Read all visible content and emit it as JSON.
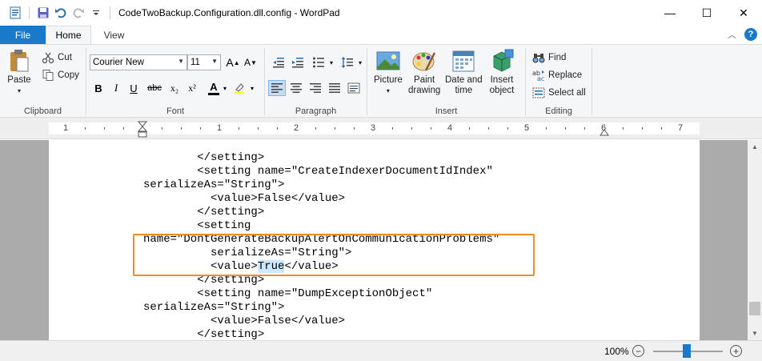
{
  "window": {
    "title": "CodeTwoBackup.Configuration.dll.config - WordPad",
    "minimize": "—",
    "maximize": "☐",
    "close": "✕"
  },
  "tabs": [
    {
      "label": "File"
    },
    {
      "label": "Home"
    },
    {
      "label": "View"
    }
  ],
  "ribbon": {
    "clipboard": {
      "label": "Clipboard",
      "paste": "Paste",
      "cut": "Cut",
      "copy": "Copy"
    },
    "font": {
      "label": "Font",
      "family": "Courier New",
      "size": "11",
      "bold": "B",
      "italic": "I",
      "underline": "U",
      "strike": "abc",
      "subscript": "x₂",
      "superscript": "x²",
      "font_color": "A"
    },
    "paragraph": {
      "label": "Paragraph"
    },
    "insert": {
      "label": "Insert",
      "picture": "Picture",
      "paint_line1": "Paint",
      "paint_line2": "drawing",
      "datetime_line1": "Date and",
      "datetime_line2": "time",
      "object_line1": "Insert",
      "object_line2": "object"
    },
    "editing": {
      "label": "Editing",
      "find": "Find",
      "replace": "Replace",
      "select_all": "Select all"
    }
  },
  "ruler": {
    "numbers": [
      "1",
      "1",
      "2",
      "3",
      "4",
      "5",
      "6",
      "7"
    ]
  },
  "document": {
    "lines": [
      "        </setting>",
      "        <setting name=\"CreateIndexerDocumentIdIndex\"",
      "serializeAs=\"String\">",
      "          <value>False</value>",
      "        </setting>",
      "        <setting",
      "name=\"DontGenerateBackupAlertOnCommunicationProblems\"",
      "          serializeAs=\"String\">",
      "          <value>",
      "        </setting>",
      "        <setting name=\"DumpExceptionObject\"",
      "serializeAs=\"String\">",
      "          <value>False</value>",
      "        </setting>"
    ],
    "selected_text": "True",
    "after_selected": "</value>"
  },
  "status": {
    "zoom": "100%",
    "zoom_out": "−",
    "zoom_in": "+"
  },
  "colors": {
    "accent": "#1979ca",
    "highlight_border": "#f28c1b",
    "selection": "#cce8ff"
  }
}
